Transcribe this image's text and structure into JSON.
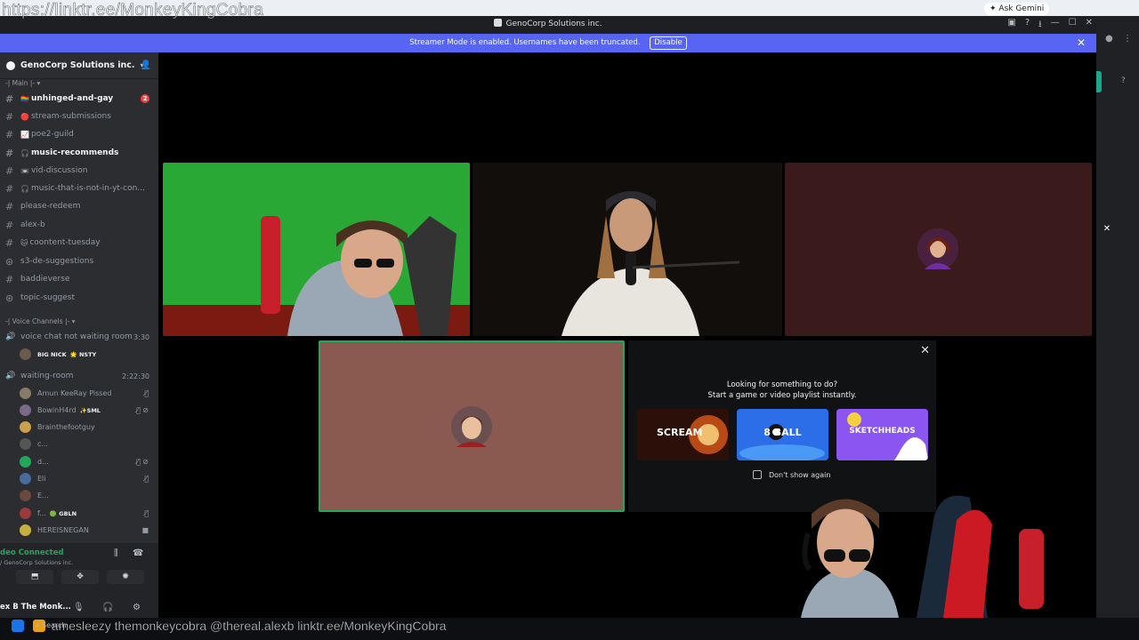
{
  "overlay": {
    "link_text": "https://linktr.ee/MonkeyKingCobra"
  },
  "browser": {
    "gemini_label": "Ask Gemini"
  },
  "window": {
    "title": "GenoCorp Solutions inc."
  },
  "streamer_bar": {
    "message": "Streamer Mode is enabled. Usernames have been truncated.",
    "disable_label": "Disable"
  },
  "server": {
    "name": "GenoCorp Solutions inc."
  },
  "categories": {
    "main": "-| Main |-",
    "voice": "-| Voice Channels |-"
  },
  "channels": [
    {
      "emoji": "🏳️‍🌈",
      "name": "unhinged-and-gay",
      "unread": true,
      "badge": "2"
    },
    {
      "emoji": "🔴",
      "name": "stream-submissions",
      "unread": false
    },
    {
      "emoji": "📈",
      "name": "poe2-guild",
      "unread": false
    },
    {
      "emoji": "🎧",
      "name": "music-recommends",
      "unread": true
    },
    {
      "emoji": "📼",
      "name": "vid-discussion",
      "unread": false
    },
    {
      "emoji": "🎧",
      "name": "music-that-is-not-in-yt-con...",
      "unread": false
    },
    {
      "emoji": "",
      "name": "please-redeem",
      "unread": false
    },
    {
      "emoji": "",
      "name": "alex-b",
      "unread": false
    },
    {
      "emoji": "🐱",
      "name": "coontent-tuesday",
      "unread": false
    },
    {
      "emoji": "",
      "name": "s3-de-suggestions",
      "unread": false
    },
    {
      "emoji": "",
      "name": "baddieverse",
      "unread": false
    },
    {
      "emoji": "",
      "name": "topic-suggest",
      "unread": false
    }
  ],
  "voice_channels": [
    {
      "name": "voice chat not waiting room",
      "timer": "3:30",
      "members": [
        {
          "name": "BIG NICK",
          "tag": "🌟 NSTY"
        }
      ]
    },
    {
      "name": "waiting-room",
      "timer": "2:22:30",
      "members": [
        {
          "name": "Amun KeeRay Pissed",
          "tag": "",
          "muted": true
        },
        {
          "name": "BowinH4rd",
          "tag": "✨SML",
          "muted": true
        },
        {
          "name": "Brainthefootguy",
          "tag": "",
          "muted": false
        },
        {
          "name": "c...",
          "tag": "",
          "muted": false
        },
        {
          "name": "d...",
          "tag": "",
          "muted": true
        },
        {
          "name": "Eli",
          "tag": "",
          "muted": true
        },
        {
          "name": "E...",
          "tag": "",
          "muted": false
        },
        {
          "name": "f...",
          "tag": "🟢 GBLN",
          "muted": true
        },
        {
          "name": "HEREISNEGAN",
          "tag": "",
          "muted": false
        }
      ]
    }
  ],
  "voice_panel": {
    "status": "deo Connected",
    "sub": "/ GenoCorp Solutions inc.",
    "username": "ex B The Monk..."
  },
  "activity": {
    "title_line1": "Looking for something to do?",
    "title_line2": "Start a game or video playlist instantly.",
    "games": [
      {
        "label": "SCREAM",
        "color": "#3a1810"
      },
      {
        "label": "8 BALL",
        "color": "#1e5bd6"
      },
      {
        "label": "SKETCHHEADS",
        "color": "#7b3fe4"
      }
    ],
    "dont_show_label": "Don't show again"
  },
  "bottom_overlay": {
    "handles": "amesleezy  themonkeycobra  @thereal.alexb  linktr.ee/MonkeyKingCobra",
    "search": "Search"
  }
}
